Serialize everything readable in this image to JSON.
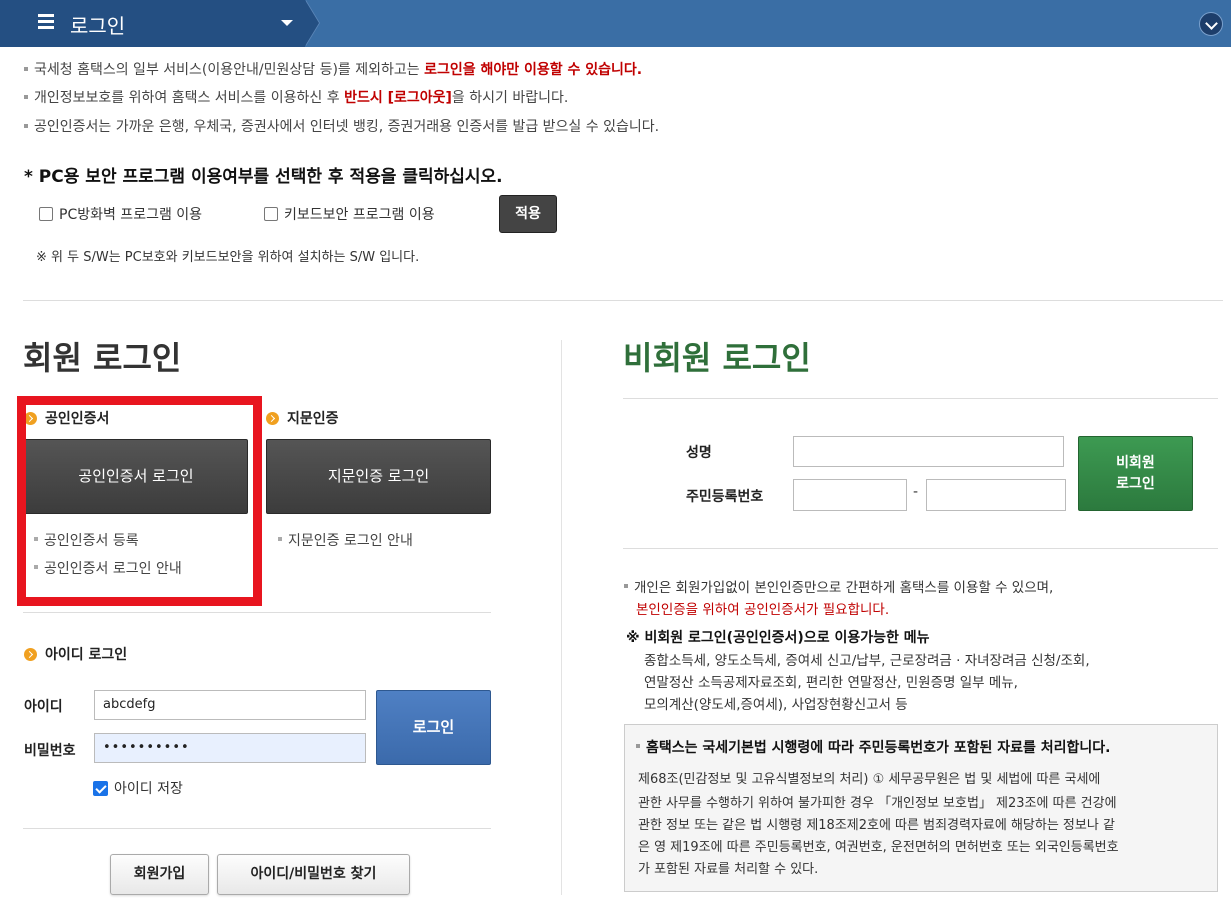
{
  "header": {
    "title": "로그인"
  },
  "notices": [
    {
      "pre": "국세청 홈택스의 일부 서비스(이용안내/민원상담 등)를 제외하고는 ",
      "red": "로그인을 해야만 이용할 수 있습니다.",
      "post": ""
    },
    {
      "pre": "개인정보보호를 위하여 홈택스 서비스를 이용하신 후 ",
      "red": "반드시 [로그아웃]",
      "post": "을 하시기 바랍니다."
    },
    {
      "pre": "공인인증서는 가까운 은행, 우체국, 증권사에서 인터넷 뱅킹, 증권거래용 인증서를 발급 받으실 수 있습니다.",
      "red": "",
      "post": ""
    }
  ],
  "security": {
    "title": "* PC용 보안 프로그램 이용여부를 선택한 후 적용을 클릭하십시오.",
    "firewall_label": "PC방화벽 프로그램 이용",
    "keyboard_label": "키보드보안 프로그램 이용",
    "apply_label": "적용",
    "note": "※ 위 두 S/W는 PC보호와 키보드보안을 위하여 설치하는 S/W 입니다."
  },
  "member": {
    "title": "회원 로그인",
    "cert_section": "공인인증서",
    "cert_login_button": "공인인증서 로그인",
    "cert_register": "공인인증서 등록",
    "cert_guide": "공인인증서 로그인 안내",
    "finger_section": "지문인증",
    "finger_login_button": "지문인증 로그인",
    "finger_guide": "지문인증 로그인 안내",
    "id_section": "아이디 로그인",
    "id_label": "아이디",
    "id_value": "abcdefg",
    "pw_label": "비밀번호",
    "pw_value": "••••••••••",
    "login_button": "로그인",
    "save_id_label": "아이디 저장",
    "signup_button": "회원가입",
    "find_button": "아이디/비밀번호 찾기"
  },
  "nonmember": {
    "title": "비회원 로그인",
    "name_label": "성명",
    "rrn_label": "주민등록번호",
    "login_button_line1": "비회원",
    "login_button_line2": "로그인",
    "dash": "-",
    "desc_line1": "개인은 회원가입없이 본인인증만으로 간편하게 홈택스를 이용할 수 있으며,",
    "desc_line2": "본인인증을 위하여 공인인증서가 필요합니다.",
    "menu_title": "※ 비회원 로그인(공인인증서)으로 이용가능한 메뉴",
    "menu_lines": [
      "종합소득세, 양도소득세, 증여세 신고/납부, 근로장려금 · 자녀장려금 신청/조회,",
      "연말정산 소득공제자료조회, 편리한 연말정산, 민원증명 일부 메뉴,",
      "모의계산(양도세,증여세), 사업장현황신고서 등"
    ],
    "info_title": "홈택스는 국세기본법 시행령에 따라 주민등록번호가 포함된 자료를 처리합니다.",
    "info_lines": [
      "제68조(민감정보 및 고유식별정보의 처리) ① 세무공무원은 법 및 세법에 따른 국세에",
      "관한 사무를 수행하기 위하여 불가피한 경우 「개인정보 보호법」 제23조에 따른 건강에",
      "관한 정보 또는 같은 법 시행령 제18조제2호에 따른 범죄경력자료에 해당하는 정보나 같",
      "은 영 제19조에 따른 주민등록번호, 여권번호, 운전면허의 면허번호 또는 외국인등록번호",
      "가 포함된 자료를 처리할 수 있다."
    ]
  },
  "colors": {
    "accent_red": "#c00000",
    "highlight_box": "#e8151f",
    "topbar": "#244f82",
    "nonmember_green": "#2f6f3a"
  }
}
